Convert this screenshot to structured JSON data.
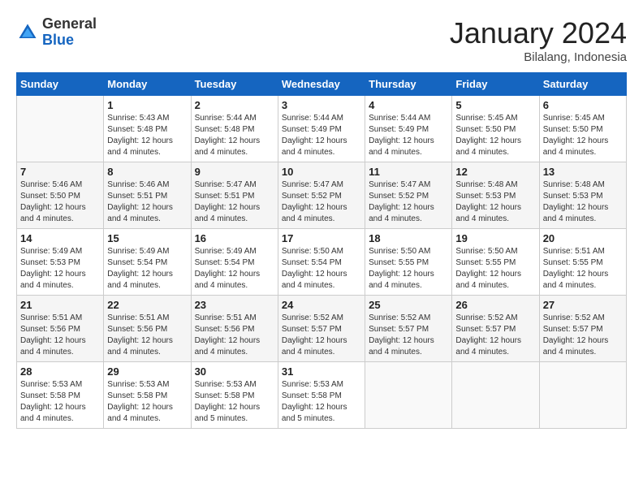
{
  "header": {
    "logo_general": "General",
    "logo_blue": "Blue",
    "title": "January 2024",
    "subtitle": "Bilalang, Indonesia"
  },
  "weekdays": [
    "Sunday",
    "Monday",
    "Tuesday",
    "Wednesday",
    "Thursday",
    "Friday",
    "Saturday"
  ],
  "weeks": [
    [
      {
        "day": "",
        "sunrise": "",
        "sunset": "",
        "daylight": ""
      },
      {
        "day": "1",
        "sunrise": "Sunrise: 5:43 AM",
        "sunset": "Sunset: 5:48 PM",
        "daylight": "Daylight: 12 hours and 4 minutes."
      },
      {
        "day": "2",
        "sunrise": "Sunrise: 5:44 AM",
        "sunset": "Sunset: 5:48 PM",
        "daylight": "Daylight: 12 hours and 4 minutes."
      },
      {
        "day": "3",
        "sunrise": "Sunrise: 5:44 AM",
        "sunset": "Sunset: 5:49 PM",
        "daylight": "Daylight: 12 hours and 4 minutes."
      },
      {
        "day": "4",
        "sunrise": "Sunrise: 5:44 AM",
        "sunset": "Sunset: 5:49 PM",
        "daylight": "Daylight: 12 hours and 4 minutes."
      },
      {
        "day": "5",
        "sunrise": "Sunrise: 5:45 AM",
        "sunset": "Sunset: 5:50 PM",
        "daylight": "Daylight: 12 hours and 4 minutes."
      },
      {
        "day": "6",
        "sunrise": "Sunrise: 5:45 AM",
        "sunset": "Sunset: 5:50 PM",
        "daylight": "Daylight: 12 hours and 4 minutes."
      }
    ],
    [
      {
        "day": "7",
        "sunrise": "Sunrise: 5:46 AM",
        "sunset": "Sunset: 5:50 PM",
        "daylight": "Daylight: 12 hours and 4 minutes."
      },
      {
        "day": "8",
        "sunrise": "Sunrise: 5:46 AM",
        "sunset": "Sunset: 5:51 PM",
        "daylight": "Daylight: 12 hours and 4 minutes."
      },
      {
        "day": "9",
        "sunrise": "Sunrise: 5:47 AM",
        "sunset": "Sunset: 5:51 PM",
        "daylight": "Daylight: 12 hours and 4 minutes."
      },
      {
        "day": "10",
        "sunrise": "Sunrise: 5:47 AM",
        "sunset": "Sunset: 5:52 PM",
        "daylight": "Daylight: 12 hours and 4 minutes."
      },
      {
        "day": "11",
        "sunrise": "Sunrise: 5:47 AM",
        "sunset": "Sunset: 5:52 PM",
        "daylight": "Daylight: 12 hours and 4 minutes."
      },
      {
        "day": "12",
        "sunrise": "Sunrise: 5:48 AM",
        "sunset": "Sunset: 5:53 PM",
        "daylight": "Daylight: 12 hours and 4 minutes."
      },
      {
        "day": "13",
        "sunrise": "Sunrise: 5:48 AM",
        "sunset": "Sunset: 5:53 PM",
        "daylight": "Daylight: 12 hours and 4 minutes."
      }
    ],
    [
      {
        "day": "14",
        "sunrise": "Sunrise: 5:49 AM",
        "sunset": "Sunset: 5:53 PM",
        "daylight": "Daylight: 12 hours and 4 minutes."
      },
      {
        "day": "15",
        "sunrise": "Sunrise: 5:49 AM",
        "sunset": "Sunset: 5:54 PM",
        "daylight": "Daylight: 12 hours and 4 minutes."
      },
      {
        "day": "16",
        "sunrise": "Sunrise: 5:49 AM",
        "sunset": "Sunset: 5:54 PM",
        "daylight": "Daylight: 12 hours and 4 minutes."
      },
      {
        "day": "17",
        "sunrise": "Sunrise: 5:50 AM",
        "sunset": "Sunset: 5:54 PM",
        "daylight": "Daylight: 12 hours and 4 minutes."
      },
      {
        "day": "18",
        "sunrise": "Sunrise: 5:50 AM",
        "sunset": "Sunset: 5:55 PM",
        "daylight": "Daylight: 12 hours and 4 minutes."
      },
      {
        "day": "19",
        "sunrise": "Sunrise: 5:50 AM",
        "sunset": "Sunset: 5:55 PM",
        "daylight": "Daylight: 12 hours and 4 minutes."
      },
      {
        "day": "20",
        "sunrise": "Sunrise: 5:51 AM",
        "sunset": "Sunset: 5:55 PM",
        "daylight": "Daylight: 12 hours and 4 minutes."
      }
    ],
    [
      {
        "day": "21",
        "sunrise": "Sunrise: 5:51 AM",
        "sunset": "Sunset: 5:56 PM",
        "daylight": "Daylight: 12 hours and 4 minutes."
      },
      {
        "day": "22",
        "sunrise": "Sunrise: 5:51 AM",
        "sunset": "Sunset: 5:56 PM",
        "daylight": "Daylight: 12 hours and 4 minutes."
      },
      {
        "day": "23",
        "sunrise": "Sunrise: 5:51 AM",
        "sunset": "Sunset: 5:56 PM",
        "daylight": "Daylight: 12 hours and 4 minutes."
      },
      {
        "day": "24",
        "sunrise": "Sunrise: 5:52 AM",
        "sunset": "Sunset: 5:57 PM",
        "daylight": "Daylight: 12 hours and 4 minutes."
      },
      {
        "day": "25",
        "sunrise": "Sunrise: 5:52 AM",
        "sunset": "Sunset: 5:57 PM",
        "daylight": "Daylight: 12 hours and 4 minutes."
      },
      {
        "day": "26",
        "sunrise": "Sunrise: 5:52 AM",
        "sunset": "Sunset: 5:57 PM",
        "daylight": "Daylight: 12 hours and 4 minutes."
      },
      {
        "day": "27",
        "sunrise": "Sunrise: 5:52 AM",
        "sunset": "Sunset: 5:57 PM",
        "daylight": "Daylight: 12 hours and 4 minutes."
      }
    ],
    [
      {
        "day": "28",
        "sunrise": "Sunrise: 5:53 AM",
        "sunset": "Sunset: 5:58 PM",
        "daylight": "Daylight: 12 hours and 4 minutes."
      },
      {
        "day": "29",
        "sunrise": "Sunrise: 5:53 AM",
        "sunset": "Sunset: 5:58 PM",
        "daylight": "Daylight: 12 hours and 4 minutes."
      },
      {
        "day": "30",
        "sunrise": "Sunrise: 5:53 AM",
        "sunset": "Sunset: 5:58 PM",
        "daylight": "Daylight: 12 hours and 5 minutes."
      },
      {
        "day": "31",
        "sunrise": "Sunrise: 5:53 AM",
        "sunset": "Sunset: 5:58 PM",
        "daylight": "Daylight: 12 hours and 5 minutes."
      },
      {
        "day": "",
        "sunrise": "",
        "sunset": "",
        "daylight": ""
      },
      {
        "day": "",
        "sunrise": "",
        "sunset": "",
        "daylight": ""
      },
      {
        "day": "",
        "sunrise": "",
        "sunset": "",
        "daylight": ""
      }
    ]
  ]
}
